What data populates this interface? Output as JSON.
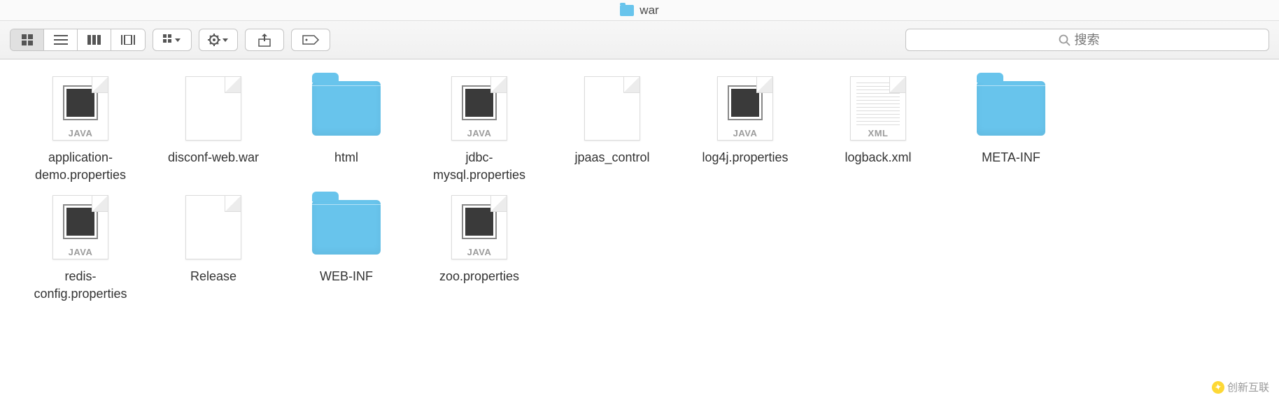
{
  "window": {
    "title": "war"
  },
  "toolbar": {
    "search_placeholder": "搜索"
  },
  "items": [
    {
      "name": "application-\ndemo.properties",
      "type": "java"
    },
    {
      "name": "disconf-web.war",
      "type": "file"
    },
    {
      "name": "html",
      "type": "folder"
    },
    {
      "name": "jdbc-\nmysql.properties",
      "type": "java"
    },
    {
      "name": "jpaas_control",
      "type": "file"
    },
    {
      "name": "log4j.properties",
      "type": "java"
    },
    {
      "name": "logback.xml",
      "type": "xml"
    },
    {
      "name": "META-INF",
      "type": "folder"
    },
    {
      "name": "redis-\nconfig.properties",
      "type": "java"
    },
    {
      "name": "Release",
      "type": "file"
    },
    {
      "name": "WEB-INF",
      "type": "folder"
    },
    {
      "name": "zoo.properties",
      "type": "java"
    }
  ],
  "badges": {
    "java": "JAVA",
    "xml": "XML"
  },
  "watermark": "创新互联"
}
